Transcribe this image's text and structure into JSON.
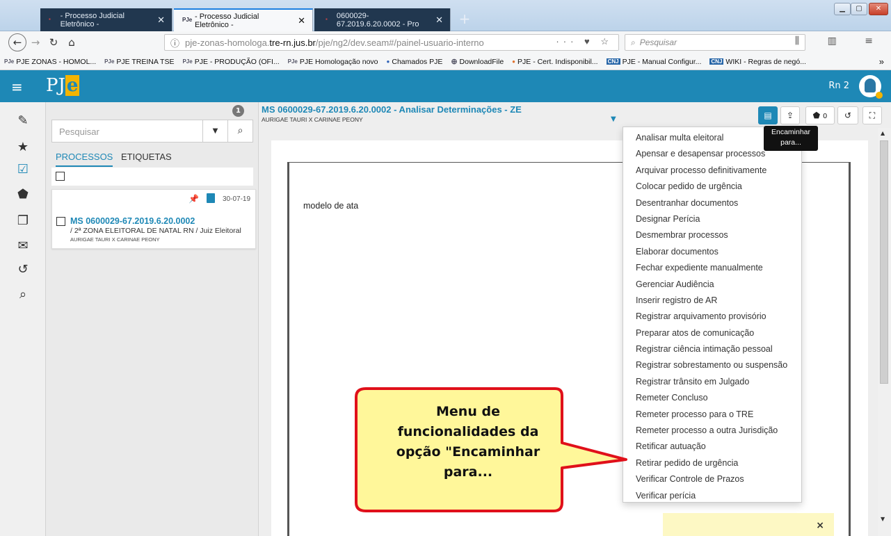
{
  "browser": {
    "tabs": [
      {
        "label": "- Processo Judicial Eletrônico -",
        "active": false
      },
      {
        "label": "- Processo Judicial Eletrônico -",
        "active": true
      },
      {
        "label": "0600029-67.2019.6.20.0002 - Pro",
        "active": false
      }
    ],
    "url_prefix": "pje-zonas-homologa.",
    "url_host": "tre-rn.jus.br",
    "url_path": "/pje/ng2/dev.seam#/painel-usuario-interno",
    "search_placeholder": "Pesquisar",
    "bookmarks": [
      "PJE ZONAS - HOMOL...",
      "PJE TREINA TSE",
      "PJE - PRODUÇÃO (OFI...",
      "PJE Homologação novo",
      "Chamados PJE",
      "DownloadFile",
      "PJE - Cert. Indisponibil...",
      "PJE - Manual Configur...",
      "WIKI - Regras de negó..."
    ]
  },
  "header": {
    "logo": "PJ",
    "logo_accent": "e",
    "user": "Rn 2",
    "accent_color": "#1e88b6"
  },
  "list_panel": {
    "count_badge": "1",
    "search_placeholder": "Pesquisar",
    "tab_processos": "PROCESSOS",
    "tab_etiquetas": "ETIQUETAS",
    "card": {
      "date": "30-07-19",
      "number": "MS 0600029-67.2019.6.20.0002",
      "org": "/ 2ª ZONA ELEITORAL DE NATAL RN / Juiz Eleitoral",
      "parts": "AURIGAE TAURI X CARINAE PEONY"
    }
  },
  "main": {
    "title": "MS 0600029-67.2019.6.20.0002 - Analisar Determinações - ZE",
    "subtitle": "AURIGAE TAURI X CARINAE PEONY",
    "tag_count": "0",
    "tooltip": "Encaminhar para...",
    "doc_text": "modelo de ata",
    "notice_close": "×"
  },
  "menu": {
    "items": [
      "Analisar multa eleitoral",
      "Apensar e desapensar processos",
      "Arquivar processo definitivamente",
      "Colocar pedido de urgência",
      "Desentranhar documentos",
      "Designar Perícia",
      "Desmembrar processos",
      "Elaborar documentos",
      "Fechar expediente manualmente",
      "Gerenciar Audiência",
      "Inserir registro de AR",
      "Registrar arquivamento provisório",
      "Preparar atos de comunicação",
      "Registrar ciência intimação pessoal",
      "Registrar sobrestamento ou suspensão",
      "Registrar trânsito em Julgado",
      "Remeter Concluso",
      "Remeter processo para o TRE",
      "Remeter processo a outra Jurisdição",
      "Retificar autuação",
      "Retirar pedido de urgência",
      "Verificar Controle de Prazos",
      "Verificar perícia"
    ]
  },
  "callout": {
    "text": "Menu de\nfuncionalidades da\nopção  \"Encaminhar\npara...",
    "fill_color": "#fff79a",
    "border_color": "#e0101a"
  }
}
